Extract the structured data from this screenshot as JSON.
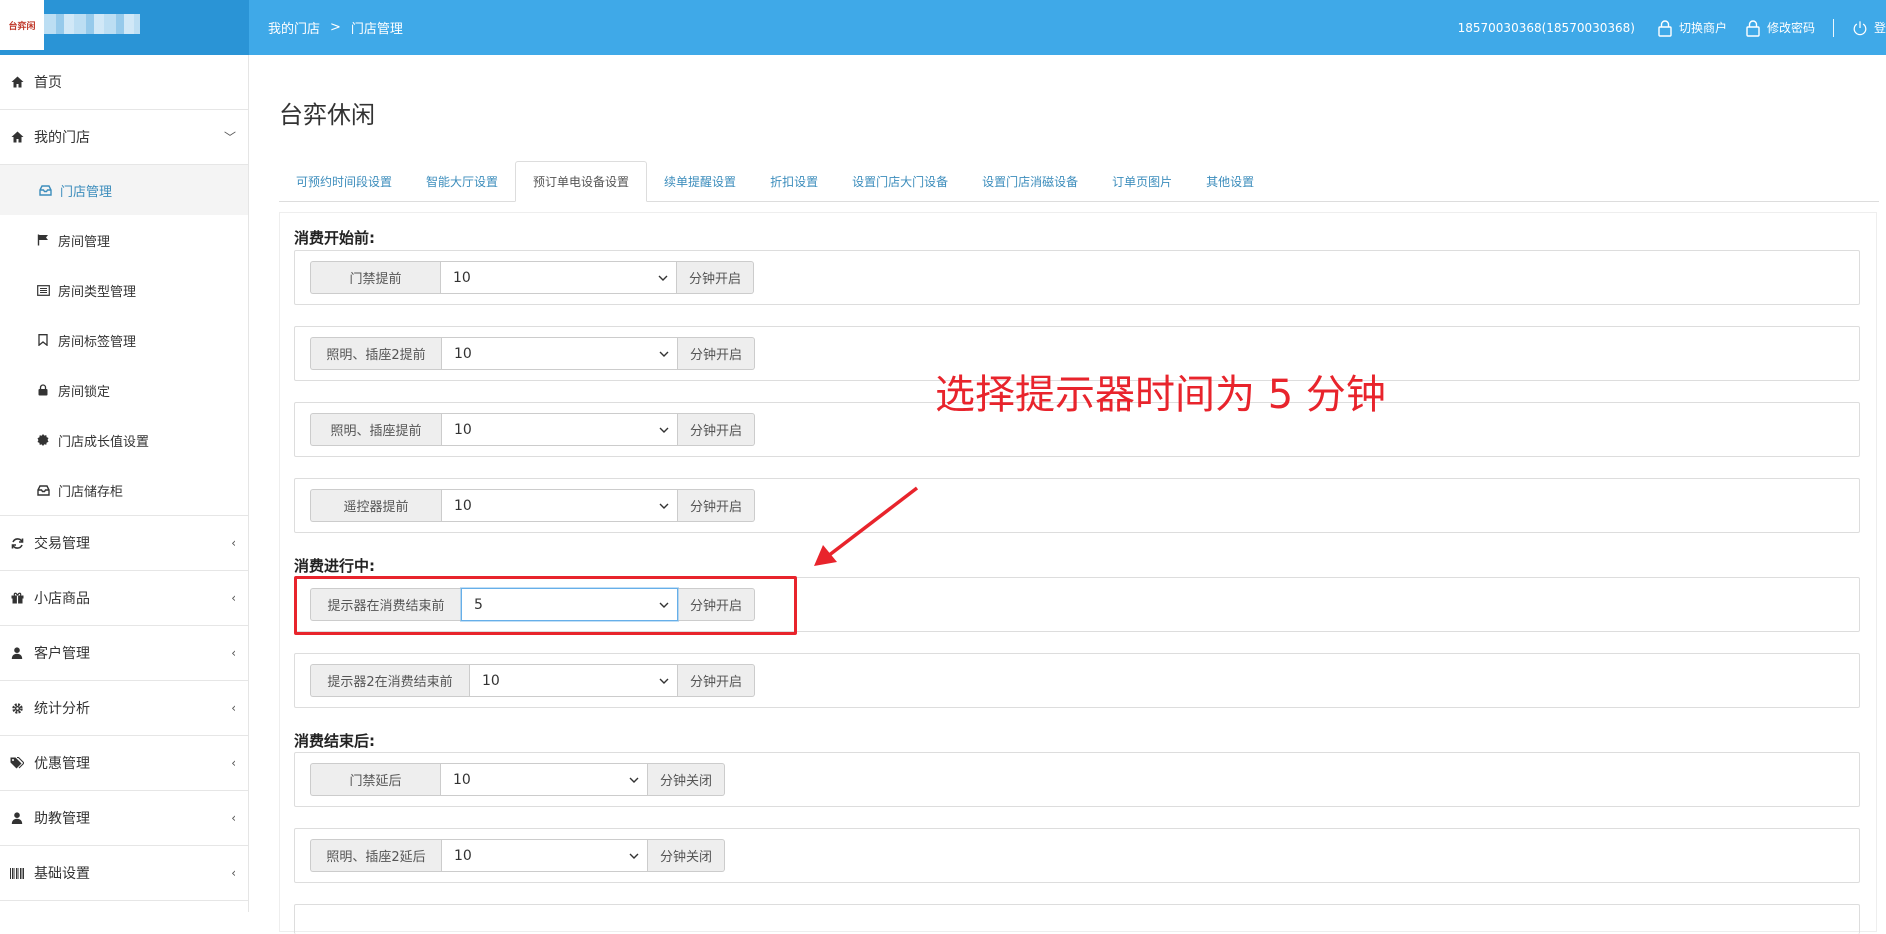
{
  "header": {
    "logo_text": "台弈闲",
    "breadcrumb": [
      "我的门店",
      ">",
      "门店管理"
    ],
    "user": "18570030368(18570030368)",
    "switch_merchant": "切换商户",
    "change_password": "修改密码",
    "logout": "登"
  },
  "sidebar": {
    "items": [
      {
        "label": "首页",
        "icon": "home-icon"
      },
      {
        "label": "我的门店",
        "icon": "home-icon",
        "chevron": "﹀"
      },
      {
        "label": "交易管理",
        "icon": "refresh-icon",
        "chevron": "‹"
      },
      {
        "label": "小店商品",
        "icon": "gift-icon",
        "chevron": "‹"
      },
      {
        "label": "客户管理",
        "icon": "user-icon",
        "chevron": "‹"
      },
      {
        "label": "统计分析",
        "icon": "gear-icon",
        "chevron": "‹"
      },
      {
        "label": "优惠管理",
        "icon": "tags-icon",
        "chevron": "‹"
      },
      {
        "label": "助教管理",
        "icon": "user-icon",
        "chevron": "‹"
      },
      {
        "label": "基础设置",
        "icon": "barcode-icon",
        "chevron": "‹"
      }
    ],
    "sub_items": [
      {
        "label": "门店管理",
        "icon": "inbox-icon"
      },
      {
        "label": "房间管理",
        "icon": "flag-icon"
      },
      {
        "label": "房间类型管理",
        "icon": "list-icon"
      },
      {
        "label": "房间标签管理",
        "icon": "bookmark-icon"
      },
      {
        "label": "房间锁定",
        "icon": "lock-icon"
      },
      {
        "label": "门店成长值设置",
        "icon": "certificate-icon"
      },
      {
        "label": "门店储存柜",
        "icon": "inbox-icon"
      }
    ]
  },
  "main": {
    "title": "台弈休闲",
    "tabs": [
      "可预约时间段设置",
      "智能大厅设置",
      "预订单电设备设置",
      "续单提醒设置",
      "折扣设置",
      "设置门店大门设备",
      "设置门店消磁设备",
      "订单页图片",
      "其他设置"
    ],
    "active_tab": 2,
    "sections": [
      {
        "label": "消费开始前:"
      },
      {
        "label": "消费进行中:"
      },
      {
        "label": "消费结束后:"
      }
    ],
    "rows": [
      {
        "label": "门禁提前",
        "value": "10",
        "suffix": "分钟开启"
      },
      {
        "label": "照明、插座2提前",
        "value": "10",
        "suffix": "分钟开启"
      },
      {
        "label": "照明、插座提前",
        "value": "10",
        "suffix": "分钟开启"
      },
      {
        "label": "遥控器提前",
        "value": "10",
        "suffix": "分钟开启"
      },
      {
        "label": "提示器在消费结束前",
        "value": "5",
        "suffix": "分钟开启"
      },
      {
        "label": "提示器2在消费结束前",
        "value": "10",
        "suffix": "分钟开启"
      },
      {
        "label": "门禁延后",
        "value": "10",
        "suffix": "分钟关闭"
      },
      {
        "label": "照明、插座2延后",
        "value": "10",
        "suffix": "分钟关闭"
      }
    ]
  },
  "annotation": {
    "text": "选择提示器时间为 5 分钟",
    "color": "#e8242c"
  },
  "colors": {
    "header_bg": "#3fa9e8",
    "logo_bg": "#2a94d6",
    "link": "#3c8dbc"
  }
}
